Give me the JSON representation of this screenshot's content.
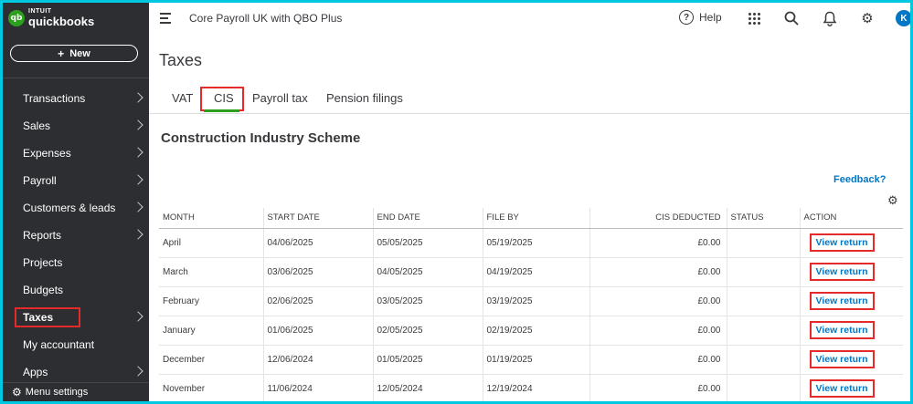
{
  "colors": {
    "sidebar_bg": "#2d2e31",
    "brand_green": "#2ca01c",
    "link_blue": "#0077c5",
    "highlight_red": "#e52a2a",
    "border_cyan": "#00c8e0"
  },
  "sidebar": {
    "logo_top": "INTUIT",
    "logo_bottom": "quickbooks",
    "logo_mark": "qb",
    "new_label": "New",
    "items": [
      {
        "label": "Transactions",
        "chevron": true
      },
      {
        "label": "Sales",
        "chevron": true
      },
      {
        "label": "Expenses",
        "chevron": true
      },
      {
        "label": "Payroll",
        "chevron": true
      },
      {
        "label": "Customers & leads",
        "chevron": true
      },
      {
        "label": "Reports",
        "chevron": true
      },
      {
        "label": "Projects",
        "chevron": false
      },
      {
        "label": "Budgets",
        "chevron": false
      },
      {
        "label": "Taxes",
        "chevron": true
      },
      {
        "label": "My accountant",
        "chevron": false
      },
      {
        "label": "Apps",
        "chevron": true
      }
    ],
    "menu_settings": "Menu settings"
  },
  "header": {
    "company": "Core Payroll UK with QBO Plus",
    "help_label": "Help",
    "avatar_initial": "K",
    "icons": [
      "menu-toggle-icon",
      "help-icon",
      "apps-grid-icon",
      "search-icon",
      "bell-icon",
      "gear-icon"
    ]
  },
  "main": {
    "title": "Taxes",
    "tabs": [
      {
        "label": "VAT"
      },
      {
        "label": "CIS"
      },
      {
        "label": "Payroll tax"
      },
      {
        "label": "Pension filings"
      }
    ],
    "active_tab": "CIS",
    "section_title": "Construction Industry Scheme",
    "feedback": "Feedback?",
    "table": {
      "headers": [
        "MONTH",
        "START DATE",
        "END DATE",
        "FILE BY",
        "CIS DEDUCTED",
        "STATUS",
        "ACTION"
      ],
      "rows": [
        {
          "month": "April",
          "start": "04/06/2025",
          "end": "05/05/2025",
          "file_by": "05/19/2025",
          "deducted": "£0.00",
          "status": "",
          "action": "View return"
        },
        {
          "month": "March",
          "start": "03/06/2025",
          "end": "04/05/2025",
          "file_by": "04/19/2025",
          "deducted": "£0.00",
          "status": "",
          "action": "View return"
        },
        {
          "month": "February",
          "start": "02/06/2025",
          "end": "03/05/2025",
          "file_by": "03/19/2025",
          "deducted": "£0.00",
          "status": "",
          "action": "View return"
        },
        {
          "month": "January",
          "start": "01/06/2025",
          "end": "02/05/2025",
          "file_by": "02/19/2025",
          "deducted": "£0.00",
          "status": "",
          "action": "View return"
        },
        {
          "month": "December",
          "start": "12/06/2024",
          "end": "01/05/2025",
          "file_by": "01/19/2025",
          "deducted": "£0.00",
          "status": "",
          "action": "View return"
        },
        {
          "month": "November",
          "start": "11/06/2024",
          "end": "12/05/2024",
          "file_by": "12/19/2024",
          "deducted": "£0.00",
          "status": "",
          "action": "View return"
        }
      ]
    }
  }
}
